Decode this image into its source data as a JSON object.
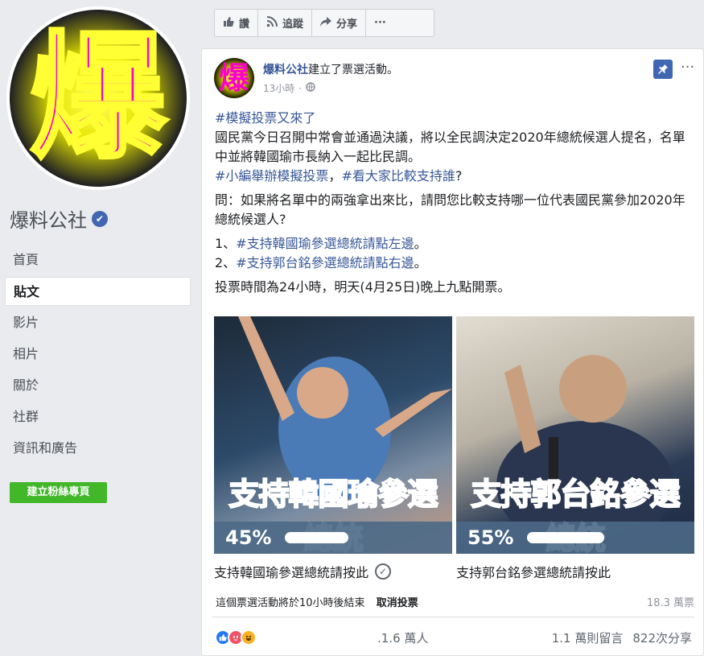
{
  "top_actions": [
    {
      "icon": "thumbs-up-icon",
      "label": "讚"
    },
    {
      "icon": "rss-icon",
      "label": "追蹤"
    },
    {
      "icon": "share-icon",
      "label": "分享"
    },
    {
      "icon": "more-icon",
      "label": "···"
    }
  ],
  "profile": {
    "avatar_char": "爆",
    "name": "爆料公社",
    "verified_glyph": "✔"
  },
  "nav": {
    "items": [
      "首頁",
      "貼文",
      "影片",
      "相片",
      "關於",
      "社群",
      "資訊和廣告"
    ],
    "active_index": 1,
    "create_button": "建立粉絲專頁"
  },
  "post": {
    "author": "爆料公社",
    "action": "建立了票選活動。",
    "time": "13小時",
    "globe_glyph": "🌐",
    "pin_glyph": "📌",
    "more_glyph": "···",
    "lines": {
      "tag1": "#模擬投票又來了",
      "para1": "國民黨今日召開中常會並通過決議，將以全民調決定2020年總統候選人提名，名單中並將韓國瑜市長納入一起比民調。",
      "tag2": "#小編舉辦模擬投票",
      "tag2_sep": "，",
      "tag3": "#看大家比較支持誰",
      "tag3_tail": "?",
      "question": "問：如果將名單中的兩強拿出來比，請問您比較支持哪一位代表國民黨參加2020年總統候選人?",
      "opt1_prefix": "1、",
      "opt1_tag": "#支持韓國瑜參選總統請點左邊",
      "opt1_tail": "。",
      "opt2_prefix": "2、",
      "opt2_tag": "#支持郭台銘參選總統請點右邊",
      "opt2_tail": "。",
      "deadline": "投票時間為24小時，明天(4月25日)晚上九點開票。"
    },
    "poll": {
      "options": [
        {
          "title_a": "支持",
          "title_hl": "韓國瑜",
          "title_b": "參選總統",
          "percent": "45%",
          "share": 0.45,
          "caption": "支持韓國瑜參選總統請按此",
          "voted": true
        },
        {
          "title_a": "支持",
          "title_hl": "郭台銘",
          "title_b": "參選總統",
          "percent": "55%",
          "share": 0.55,
          "caption": "支持郭台銘參選總統請按此",
          "voted": false
        }
      ],
      "check_glyph": "✓",
      "ends_text": "這個票選活動將於10小時後結束",
      "cancel_label": "取消投票",
      "views": "18.3 萬票"
    },
    "reactions": {
      "icons": [
        "like-reaction-icon",
        "angry-reaction-icon",
        "haha-reaction-icon"
      ],
      "like_glyph": "👍",
      "angry_glyph": "😡",
      "haha_glyph": "😆",
      "count": ".1.6 萬人"
    },
    "stats": {
      "comments": "1.1 萬則留言",
      "shares": "822次分享"
    }
  },
  "colors": {
    "brand_blue": "#4267b2",
    "link_blue": "#385898",
    "green_button": "#42b72a",
    "highlight_pink": "#e02bb3",
    "poll_title_blue": "#1d2ea6"
  }
}
